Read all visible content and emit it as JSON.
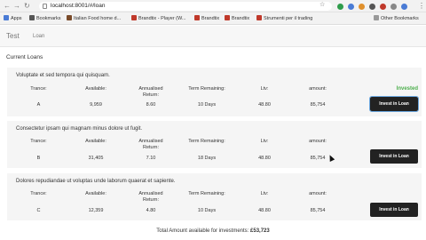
{
  "browser": {
    "url": "localhost:8001/#/loan",
    "bookmarks": [
      {
        "label": "Apps",
        "color": "#4a7bd5"
      },
      {
        "label": "Bookmarks",
        "color": "#555555"
      },
      {
        "label": "Italian Food home d...",
        "color": "#7a4b2a"
      },
      {
        "label": "Brandtix - Player (W...",
        "color": "#c0392b"
      },
      {
        "label": "Brandtix",
        "color": "#c0392b"
      },
      {
        "label": "Brandtix",
        "color": "#c0392b"
      },
      {
        "label": "Strumenti per il trading",
        "color": "#c0392b"
      }
    ],
    "other_bookmarks": "Other Bookmarks"
  },
  "nav": {
    "brand": "Test",
    "link": "Loan"
  },
  "section_title": "Current Loans",
  "headers": {
    "tranche": "Trance:",
    "available": "Available:",
    "annualised": "Annualised Return:",
    "term": "Term Remaining:",
    "ltv": "Ltv:",
    "amount": "amount:"
  },
  "invest_label": "Invest in Loan",
  "loans": [
    {
      "title": "Voluptate et sed tempora qui quisquam.",
      "tranche": "A",
      "available": "9,959",
      "annualised": "8.60",
      "term": "10 Days",
      "ltv": "48.80",
      "amount": "85,754",
      "status": "Invested"
    },
    {
      "title": "Consectetur ipsam qui magnam minus dolore ut fugit.",
      "tranche": "B",
      "available": "31,405",
      "annualised": "7.10",
      "term": "18 Days",
      "ltv": "48.80",
      "amount": "85,754",
      "status": ""
    },
    {
      "title": "Dolores repudiandae ut voluptas unde laborum quaerat et sapiente.",
      "tranche": "C",
      "available": "12,359",
      "annualised": "4.80",
      "term": "10 Days",
      "ltv": "48.80",
      "amount": "85,754",
      "status": ""
    }
  ],
  "footer": {
    "label": "Total Amount available for investments:",
    "value": "£53,723"
  }
}
